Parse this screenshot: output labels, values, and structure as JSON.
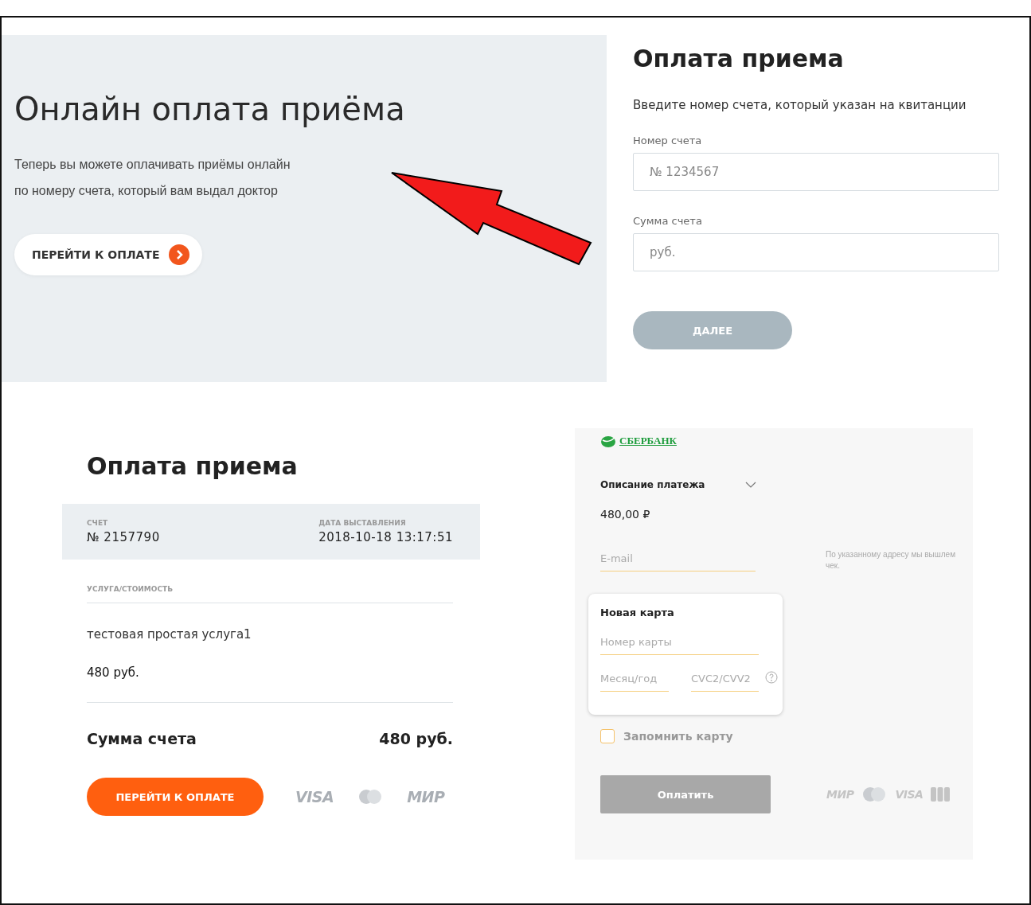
{
  "hero": {
    "title": "Онлайн оплата приёма",
    "text_lines": [
      "Теперь вы можете оплачивать приёмы онлайн",
      "по номеру счета, который вам выдал доктор"
    ],
    "button": {
      "label": "ПЕРЕЙТИ К ОПЛАТЕ"
    }
  },
  "account_form": {
    "title": "Оплата приема",
    "instruction": "Введите номер счета, который указан на квитанции",
    "fields": [
      {
        "label": "Номер счета",
        "placeholder": "№ 1234567"
      },
      {
        "label": "Сумма счета",
        "placeholder": "руб."
      }
    ],
    "submit": {
      "label": "ДАЛЕЕ",
      "disabled": true
    }
  },
  "invoice": {
    "title": "Оплата приема",
    "meta": [
      {
        "label": "СЧЕТ",
        "value": "№ 2157790"
      },
      {
        "label": "ДАТА ВЫСТАВЛЕНИЯ",
        "value": "2018-10-18 13:17:51"
      }
    ],
    "services_header": "УСЛУГА/СТОИМОСТЬ",
    "services": [
      {
        "name": "тестовая простая услуга1",
        "price": "480 руб."
      }
    ],
    "total": {
      "label": "Сумма счета",
      "value": "480 руб."
    },
    "button": {
      "label": "ПЕРЕЙТИ К ОПЛАТЕ"
    },
    "card_logos": [
      {
        "kind": "text",
        "text": "VISA"
      },
      {
        "kind": "circles"
      },
      {
        "kind": "text",
        "text": "МИР"
      }
    ]
  },
  "sberbank": {
    "bank_name": "СБЕРБАНК",
    "description": {
      "label": "Описание платежа",
      "expanded": false
    },
    "amount": "480,00 ₽",
    "email": {
      "placeholder": "E-mail",
      "hint": "По указанному адресу мы вышлем чек."
    },
    "card": {
      "title": "Новая карта",
      "number_placeholder": "Номер карты",
      "expiry_placeholder": "Месяц/год",
      "cvc_placeholder": "CVC2/CVV2"
    },
    "remember": {
      "label": "Запомнить карту",
      "checked": false
    },
    "pay_button": {
      "label": "Оплатить",
      "disabled": true
    },
    "card_logos": [
      {
        "kind": "text",
        "text": "МИР"
      },
      {
        "kind": "circles"
      },
      {
        "kind": "text",
        "text": "VISA"
      },
      {
        "kind": "card"
      }
    ]
  }
}
